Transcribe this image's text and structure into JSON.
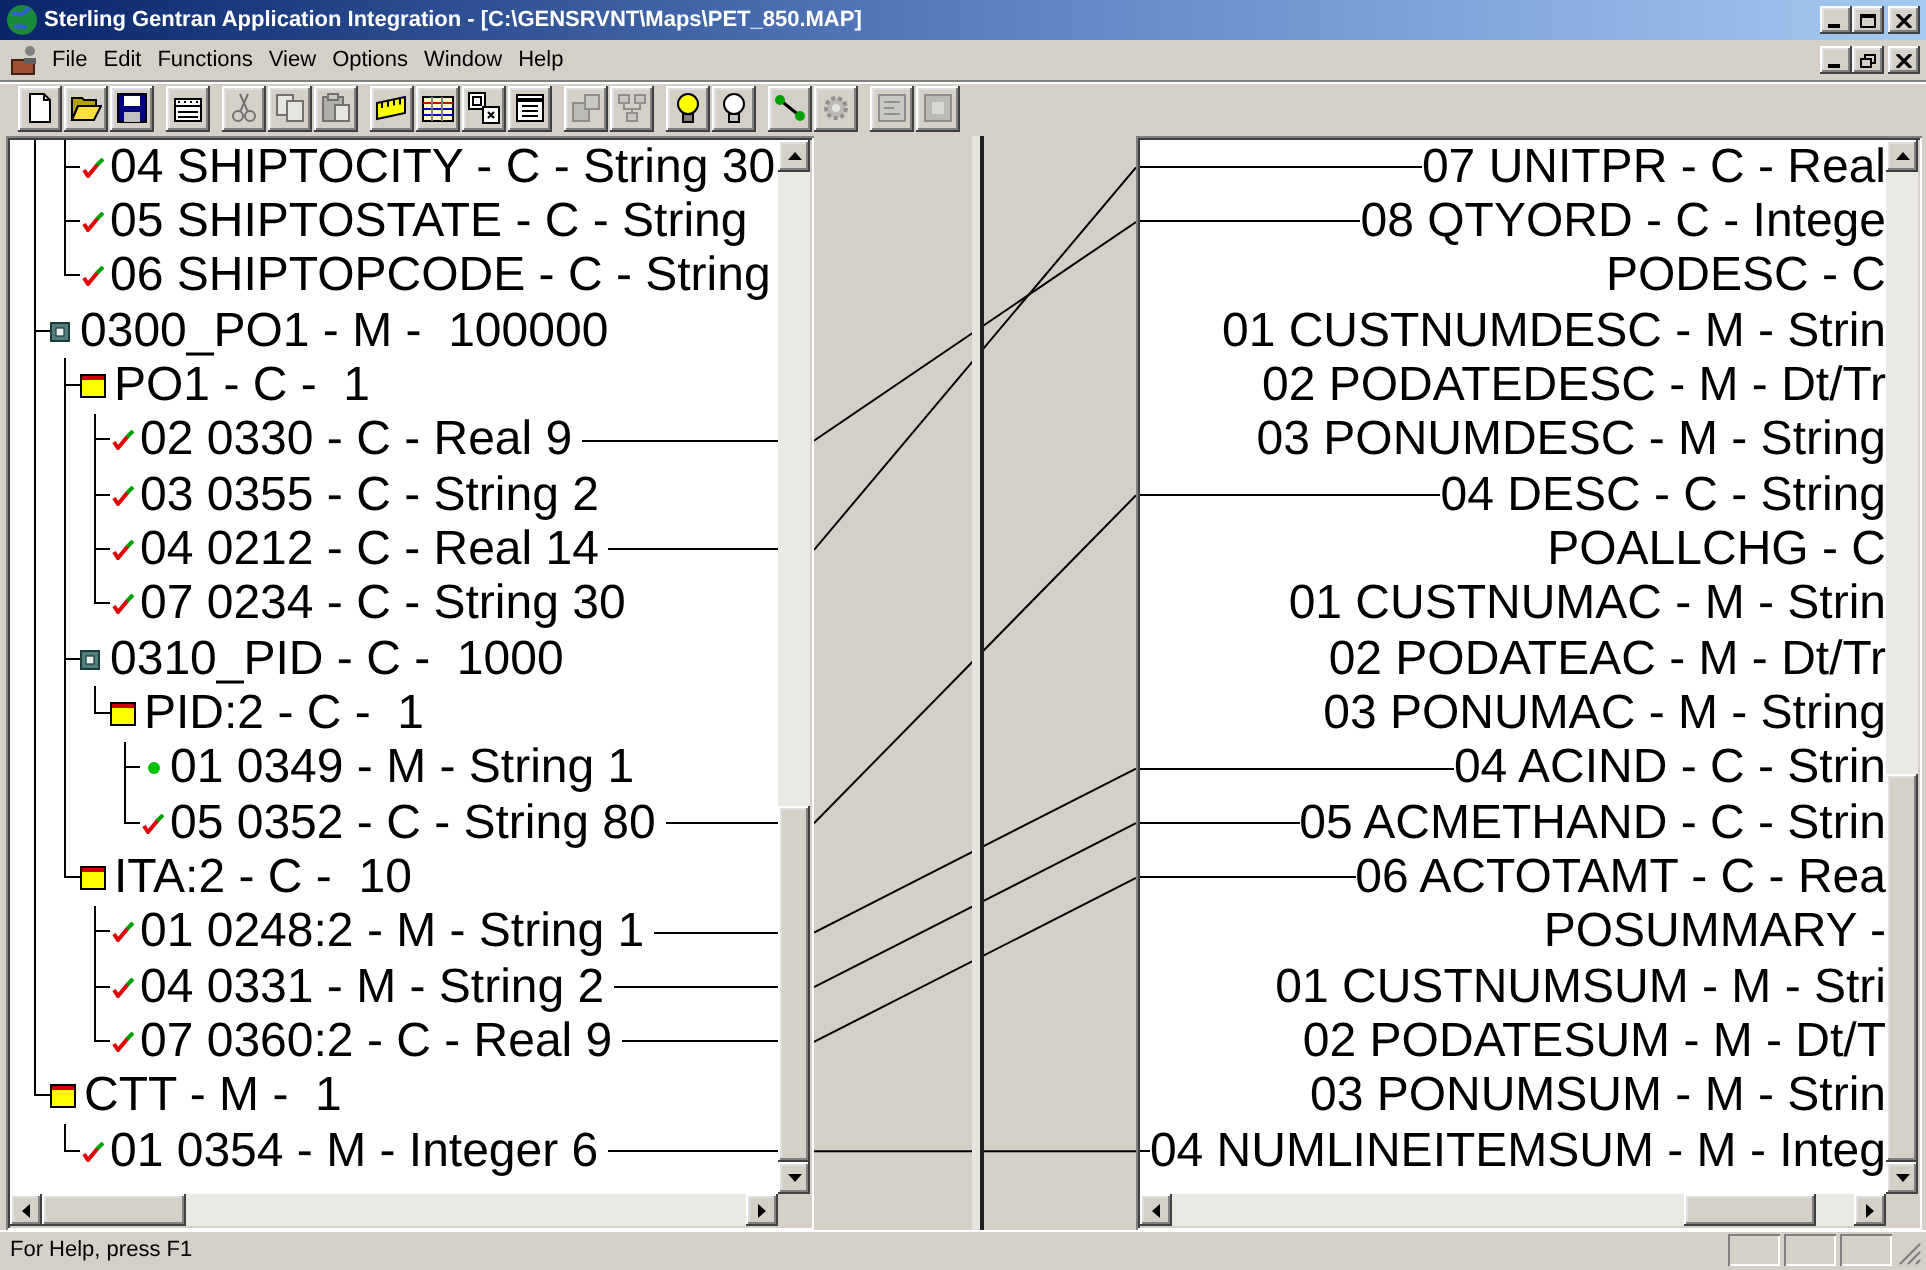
{
  "window": {
    "title": "Sterling Gentran Application Integration - [C:\\GENSRVNT\\Maps\\PET_850.MAP]"
  },
  "menu": [
    "File",
    "Edit",
    "Functions",
    "View",
    "Options",
    "Window",
    "Help"
  ],
  "toolbar": [
    {
      "buttons": [
        {
          "disabled": false
        },
        {
          "disabled": false
        },
        {
          "disabled": false
        }
      ]
    },
    {
      "buttons": [
        {
          "disabled": false
        }
      ]
    },
    {
      "buttons": [
        {
          "disabled": true
        },
        {
          "disabled": true
        },
        {
          "disabled": true
        }
      ]
    },
    {
      "buttons": [
        {
          "disabled": false
        },
        {
          "disabled": false
        },
        {
          "disabled": false
        },
        {
          "disabled": false
        }
      ]
    },
    {
      "buttons": [
        {
          "disabled": true
        },
        {
          "disabled": true
        }
      ]
    },
    {
      "buttons": [
        {
          "disabled": false
        },
        {
          "disabled": false
        }
      ]
    },
    {
      "buttons": [
        {
          "disabled": false
        },
        {
          "disabled": true
        }
      ]
    },
    {
      "buttons": [
        {
          "disabled": true
        },
        {
          "disabled": true
        }
      ]
    }
  ],
  "source_tree": [
    {
      "children": [
        {
          "label": "04 SHIPTOCITY - C - String 30",
          "kind": "field",
          "mapped": false
        },
        {
          "label": "05 SHIPTOSTATE - C - String",
          "kind": "field",
          "mapped": false
        },
        {
          "label": "06 SHIPTOPCODE - C - String",
          "kind": "field",
          "mapped": false
        }
      ]
    },
    {
      "label": "0300_PO1 - M -  100000",
      "kind": "loop",
      "children": [
        {
          "label": "PO1 - C -  1",
          "kind": "segment",
          "children": [
            {
              "label": "02 0330 - C - Real 9",
              "kind": "field",
              "mapped": true,
              "crossed": true
            },
            {
              "label": "03 0355 - C - String 2",
              "kind": "field",
              "mapped": false
            },
            {
              "label": "04 0212 - C - Real 14",
              "kind": "field",
              "mapped": true,
              "crossed": false
            },
            {
              "label": "07 0234 - C - String 30",
              "kind": "field",
              "mapped": false
            }
          ]
        },
        {
          "label": "0310_PID - C -  1000",
          "kind": "loop",
          "children": [
            {
              "label": "PID:2 - C -  1",
              "kind": "segment",
              "children": [
                {
                  "label": "01 0349 - M - String 1",
                  "kind": "bullet",
                  "mapped": false
                },
                {
                  "label": "05 0352 - C - String 80",
                  "kind": "field",
                  "mapped": true,
                  "crossed": false
                }
              ]
            }
          ]
        },
        {
          "label": "ITA:2 - C -  10",
          "kind": "segment",
          "children": [
            {
              "label": "01 0248:2 - M - String 1",
              "kind": "field",
              "mapped": true,
              "crossed": false
            },
            {
              "label": "04 0331 - M - String 2",
              "kind": "field",
              "mapped": true,
              "crossed": false
            },
            {
              "label": "07 0360:2 - C - Real 9",
              "kind": "field",
              "mapped": true,
              "crossed": false
            }
          ]
        }
      ]
    },
    {
      "label": "CTT - M -  1",
      "kind": "segment",
      "children": [
        {
          "label": "01 0354 - M - Integer 6",
          "kind": "field",
          "mapped": true
        }
      ]
    }
  ],
  "target_rows": [
    {
      "label": "07 UNITPR - C - Real",
      "mapped": true
    },
    {
      "label": "08 QTYORD - C - Intege",
      "mapped": true
    },
    {
      "label": "PODESC - C",
      "mapped": false
    },
    {
      "label": "01 CUSTNUMDESC - M - Strin",
      "mapped": false
    },
    {
      "label": "02 PODATEDESC - M - Dt/Tr",
      "mapped": false
    },
    {
      "label": "03 PONUMDESC - M - String",
      "mapped": false
    },
    {
      "label": "04 DESC - C - String",
      "mapped": true
    },
    {
      "label": "POALLCHG - C",
      "mapped": false
    },
    {
      "label": "01 CUSTNUMAC - M - Strin",
      "mapped": false
    },
    {
      "label": "02 PODATEAC - M - Dt/Tr",
      "mapped": false
    },
    {
      "label": "03 PONUMAC - M - String",
      "mapped": false
    },
    {
      "label": "04 ACIND - C - Strin",
      "mapped": true
    },
    {
      "label": "05 ACMETHAND - C - Strin",
      "mapped": true
    },
    {
      "label": "06 ACTOTAMT - C - Rea",
      "mapped": true
    },
    {
      "label": "POSUMMARY -",
      "mapped": false
    },
    {
      "label": "01 CUSTNUMSUM - M - Stri",
      "mapped": false
    },
    {
      "label": "02 PODATESUM - M - Dt/T",
      "mapped": false
    },
    {
      "label": "03 PONUMSUM - M - Strin",
      "mapped": false
    },
    {
      "label": "04 NUMLINEITEMSUM - M - Integ",
      "mapped": true
    }
  ],
  "status_bar": {
    "text": "For Help, press F1"
  }
}
